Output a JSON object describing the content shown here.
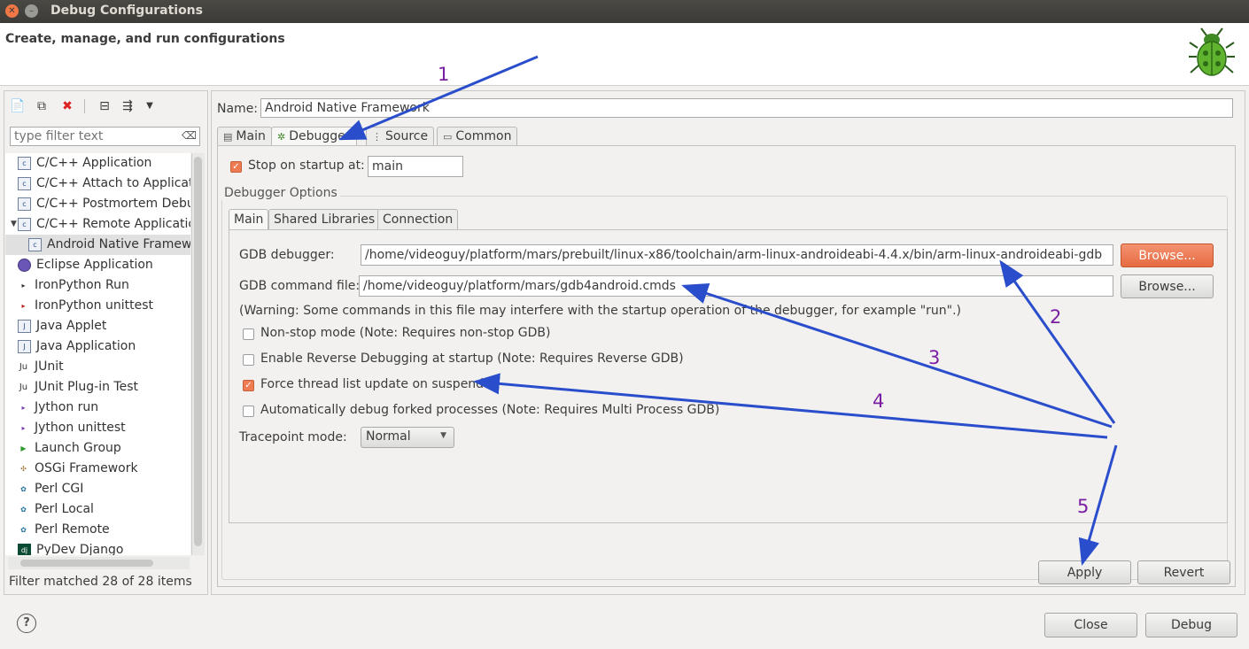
{
  "window": {
    "title": "Debug Configurations"
  },
  "header": {
    "text": "Create, manage, and run configurations",
    "icon": "bug-icon"
  },
  "left": {
    "filter_placeholder": "type filter text",
    "items": [
      {
        "label": "C/C++ Application",
        "icon": "c-app-icon"
      },
      {
        "label": "C/C++ Attach to Applicati",
        "icon": "c-app-icon"
      },
      {
        "label": "C/C++ Postmortem Debu",
        "icon": "c-app-icon"
      },
      {
        "label": "C/C++ Remote Applicatio",
        "icon": "c-app-icon"
      },
      {
        "label": "Android Native Framew",
        "icon": "c-app-icon"
      },
      {
        "label": "Eclipse Application",
        "icon": "eclipse-icon"
      },
      {
        "label": "IronPython Run",
        "icon": "python-icon"
      },
      {
        "label": "IronPython unittest",
        "icon": "python-icon"
      },
      {
        "label": "Java Applet",
        "icon": "java-icon"
      },
      {
        "label": "Java Application",
        "icon": "java-icon"
      },
      {
        "label": "JUnit",
        "icon": "junit-icon"
      },
      {
        "label": "JUnit Plug-in Test",
        "icon": "junit-icon"
      },
      {
        "label": "Jython run",
        "icon": "python-icon"
      },
      {
        "label": "Jython unittest",
        "icon": "python-icon"
      },
      {
        "label": "Launch Group",
        "icon": "launch-group-icon"
      },
      {
        "label": "OSGi Framework",
        "icon": "osgi-icon"
      },
      {
        "label": "Perl CGI",
        "icon": "perl-icon"
      },
      {
        "label": "Perl Local",
        "icon": "perl-icon"
      },
      {
        "label": "Perl Remote",
        "icon": "perl-icon"
      },
      {
        "label": "PyDev Django",
        "icon": "django-icon"
      }
    ],
    "status": "Filter matched 28 of 28 items"
  },
  "config": {
    "name_label": "Name:",
    "name_value": "Android Native Framework",
    "tabs": [
      "Main",
      "Debugger",
      "Source",
      "Common"
    ],
    "stop_label": "Stop on startup at:",
    "stop_value": "main",
    "group_title": "Debugger Options",
    "inner_tabs": [
      "Main",
      "Shared Libraries",
      "Connection"
    ],
    "gdb_label": "GDB debugger:",
    "gdb_value": "/home/videoguy/platform/mars/prebuilt/linux-x86/toolchain/arm-linux-androideabi-4.4.x/bin/arm-linux-androideabi-gdb",
    "cmd_label": "GDB command file:",
    "cmd_value": "/home/videoguy/platform/mars/gdb4android.cmds",
    "browse": "Browse...",
    "warning": "(Warning: Some commands in this file may interfere with the startup operation of the debugger, for example \"run\".)",
    "checks": [
      {
        "label": "Non-stop mode (Note: Requires non-stop GDB)",
        "checked": false
      },
      {
        "label": "Enable Reverse Debugging at startup (Note: Requires Reverse GDB)",
        "checked": false
      },
      {
        "label": "Force thread list update on suspend",
        "checked": true
      },
      {
        "label": "Automatically debug forked processes (Note: Requires Multi Process GDB)",
        "checked": false
      }
    ],
    "trace_label": "Tracepoint mode:",
    "trace_value": "Normal",
    "apply": "Apply",
    "revert": "Revert"
  },
  "footer": {
    "help": "?",
    "close": "Close",
    "debug": "Debug"
  },
  "annotations": [
    "1",
    "2",
    "3",
    "4",
    "5"
  ],
  "colors": {
    "accent": "#ef7b52",
    "arrow": "#2a4dcc",
    "annotation": "#7b1fa2"
  }
}
